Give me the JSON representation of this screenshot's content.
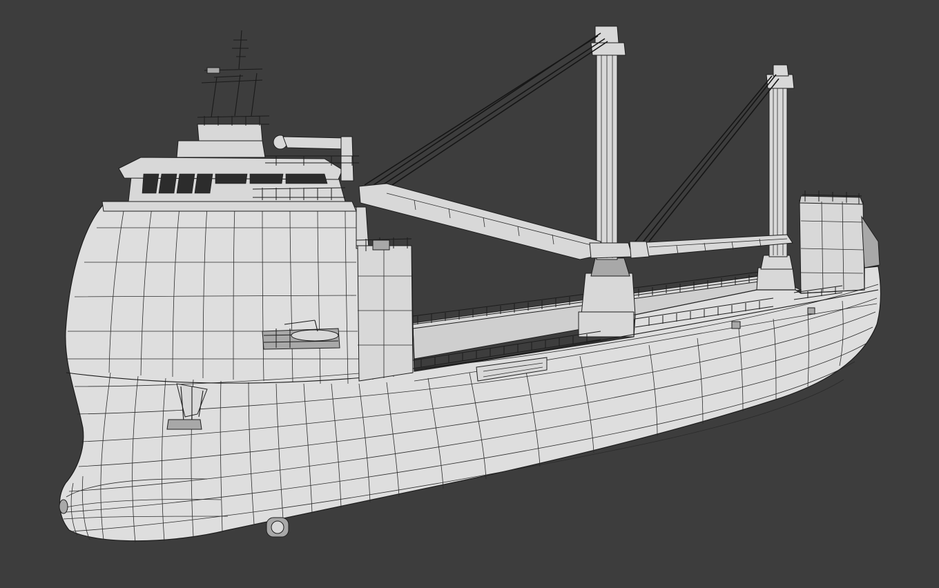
{
  "scene": {
    "subject": "",
    "render_mode": "wireframe-over-solid",
    "background_color": "#3d3d3d",
    "hull_color": "#dedede",
    "wire_color": "#1e1e1e"
  }
}
